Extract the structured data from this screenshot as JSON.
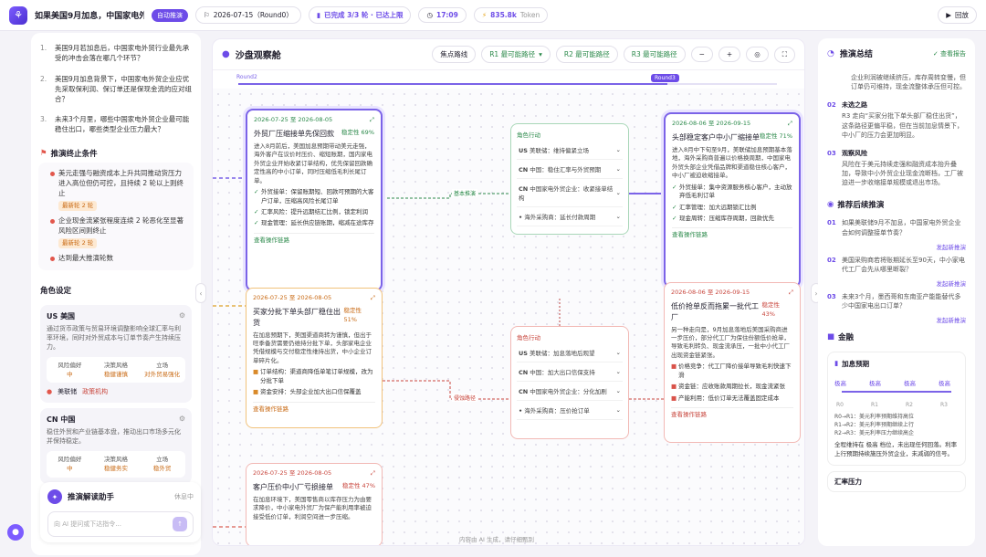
{
  "topbar": {
    "title": "如果美国9月加息，中国家电外贸...",
    "mode_badge": "自动推演",
    "date_range": "2026-07-15（Round0）",
    "progress": "已完成 3/3 轮 · 已达上限",
    "time": "17:09",
    "tokens": "835.8k",
    "tokens_unit": "Token",
    "back_label": "回放"
  },
  "left": {
    "questions": [
      {
        "n": "1.",
        "text": "美国9月若加息后，中国家电外贸行业最先承受的冲击会落在哪几个环节？"
      },
      {
        "n": "2.",
        "text": "美国9月加息背景下，中国家电外贸企业应优先采取保利润、保订单还是保现金流的应对组合？"
      },
      {
        "n": "3.",
        "text": "未来3个月里，哪些中国家电外贸企业最可能稳住出口，哪些类型企业压力最大？"
      }
    ],
    "conditions_title": "推演终止条件",
    "conditions": [
      {
        "text": "美元走强与融资成本上升共同推动货压力进入高位但仍可控，且持续 2 轮以上则终止",
        "tag": "最新轮 2 轮"
      },
      {
        "text": "企业现金流紧张程度连续 2 轮恶化至显著风险区间则终止",
        "tag": "最新轮 2 轮"
      },
      {
        "text": "达到最大推演轮数",
        "tag": ""
      }
    ],
    "roles_title": "角色设定",
    "roles": [
      {
        "code": "US",
        "name": "美国",
        "desc": "通过货币政策与贸易环境调整影响全球汇率与利率环境，同时对外贸成本与订单节奏产生持续压力。",
        "cols": [
          {
            "k": "风险偏好",
            "v": "中"
          },
          {
            "k": "决策风格",
            "v": "稳健谨慎"
          },
          {
            "k": "立场",
            "v": "对外贸易强化"
          }
        ],
        "rep": "美联储",
        "rep_tag": "政策机构"
      },
      {
        "code": "CN",
        "name": "中国",
        "desc": "稳住外贸和产业链基本盘，推动出口市场多元化并保持稳定。",
        "cols": [
          {
            "k": "风险偏好",
            "v": "中"
          },
          {
            "k": "决策风格",
            "v": "稳健务实"
          },
          {
            "k": "立场",
            "v": "稳外贸"
          }
        ]
      }
    ],
    "chat_title": "推演解读助手",
    "chat_status": "休息中",
    "chat_placeholder": "向 AI 提问或下达指令..."
  },
  "center": {
    "title": "沙盘观察舱",
    "tool_labels": [
      "焦点路线",
      "R1 最可能路径",
      "R2 最可能路径",
      "R3 最可能路径"
    ],
    "rounds": [
      "Round2",
      "Round3"
    ],
    "footer": "内容由 AI 生成，请仔细甄别",
    "edge_labels": [
      "基本推演",
      "侵蚀路径"
    ],
    "nodes": [
      {
        "date": "2026-07-25 至 2026-08-05",
        "title": "外贸厂压缩接单先保回款",
        "prob": "稳定性 69%",
        "body": "进入8月前后，美国加息预期带动美元走强，海外客户在议价时压价、缩短账期，国内家电外贸企业开始收紧订单结构，优先保留回款确定性高的中小订单，同时压缩低毛利长尾订单。",
        "bullets": [
          "外贸接单：保留账期短、回款可预期的大客户订单，压缩高风险长尾订单",
          "汇率风险：提升远期结汇比例，锁定利润",
          "现金管理：延长供应链账期，缩减在途库存"
        ],
        "foot": "查看操作链路"
      },
      {
        "date": "2026-07-25 至 2026-08-05",
        "title": "买家分批下单头部厂稳住出货",
        "prob": "稳定性 51%",
        "body": "在加息预期下，美国渠道商转为谨慎，但出于旺季备货需要仍维持分批下单，头部家电企业凭借规模与交付稳定性维持出货，中小企业订单碎片化。",
        "bullets": [
          "订单结构：渠道商降低单笔订单规模，改为分批下单",
          "资金安排：头部企业加大出口信保覆盖",
          "价格策略：中小厂被迫让利保单"
        ],
        "foot": "查看操作链路"
      },
      {
        "date": "2026-07-25 至 2026-08-05",
        "title": "客户压价中小厂亏损接单",
        "prob": "稳定性 47%",
        "body": "在加息环境下，美国零售商以库存压力为由要求降价，中小家电外贸厂为保产能利用率被迫接受低价订单，利润空间进一步压缩。"
      },
      {
        "date": "2026-08-06 至 2026-09-15",
        "title": "头部稳定客户中小厂缩接单",
        "prob": "稳定性 71%",
        "body": "进入8月中下旬至9月，美联储加息预期基本落地，海外采购商普遍以价格换周期，中国家电外贸头部企业凭借品牌和渠道稳住核心客户，中小厂被迫收缩接单。",
        "bullets": [
          "外贸接单：集中资源服务核心客户，主动放弃低毛利订单",
          "汇率管理：加大远期锁汇比例",
          "现金周转：压缩库存周期，回款优先"
        ],
        "foot": "查看操作链路"
      },
      {
        "date": "2026-08-06 至 2026-09-15",
        "title": "低价抢单反而拖累一批代工厂",
        "prob": "稳定性 43%",
        "body": "另一种走向是，9月加息落地后美国采购商进一步压价，部分代工厂为保住份额低价抢单，导致毛利转负、现金流承压，一批中小代工厂出现资金链紧张。",
        "bullets": [
          "价格竞争：代工厂降价接单导致毛利快速下滑",
          "资金链：应收账款周期拉长，现金流紧张",
          "产能利用：低价订单无法覆盖固定成本"
        ],
        "foot": "查看操作链路"
      }
    ],
    "role_nodes": [
      {
        "head": "角色行动",
        "rows": [
          {
            "c": "US",
            "t": "美联储：维持偏紧立场"
          },
          {
            "c": "CN",
            "t": "中国：稳住汇率与外贸预期"
          },
          {
            "c": "CN",
            "t": "中国家电外贸企业：收紧接单结构"
          },
          {
            "c": "•",
            "t": "海外采购商：延长付款周期"
          }
        ]
      },
      {
        "head": "角色行动",
        "rows": [
          {
            "c": "US",
            "t": "美联储：加息落地后观望"
          },
          {
            "c": "CN",
            "t": "中国：加大出口信保支持"
          },
          {
            "c": "CN",
            "t": "中国家电外贸企业：分化加剧"
          },
          {
            "c": "•",
            "t": "海外采购商：压价抢订单"
          }
        ]
      }
    ]
  },
  "right": {
    "title": "推演总结",
    "report_label": "查看报告",
    "summary_top": "企业利润被继续挤压，库存周转变慢，但订单仍可维持，现金流整体承压但可控。",
    "items": [
      {
        "n": "02",
        "title": "未选之路",
        "text": "R3 走向“买家分批下单头部厂稳住出货”，这条路径更偏平稳，但在当前加息情景下，中小厂的压力会更加明显。"
      },
      {
        "n": "03",
        "title": "观察风险",
        "text": "风险在于美元持续走强和融资成本抬升叠加，导致中小外贸企业现金流断档，工厂被迫进一步收缩接单规模或退出市场。"
      }
    ],
    "followup_title": "推荐后续推演",
    "followups": [
      {
        "n": "01",
        "text": "如果美联储9月不加息，中国家电外贸企业会如何调整接单节奏？",
        "link": "发起新推演"
      },
      {
        "n": "02",
        "text": "美国采购商若将账期延长至90天，中小家电代工厂会先从哪里断裂？",
        "link": "发起新推演"
      },
      {
        "n": "03",
        "text": "未来3个月，墨西哥和东南亚产能能替代多少中国家电出口订单？",
        "link": "发起新推演"
      }
    ],
    "metrics_title": "金融",
    "forecast_title": "加息预期",
    "forecast_points": [
      "极高",
      "极高",
      "极高",
      "极高"
    ],
    "forecast_axis": [
      "R0",
      "R1",
      "R2",
      "R3"
    ],
    "forecast_notes": [
      "R0→R1：美元利率预期维持高位",
      "R1→R2：美元利率预期继续上行",
      "R2→R3：美元利率压力继续高企"
    ],
    "forecast_summary": "全程维持在 极高 档位，未出现任何回落。利率上行预期持续施压外贸企业，未减弱的信号。",
    "fx_title": "汇率压力"
  }
}
